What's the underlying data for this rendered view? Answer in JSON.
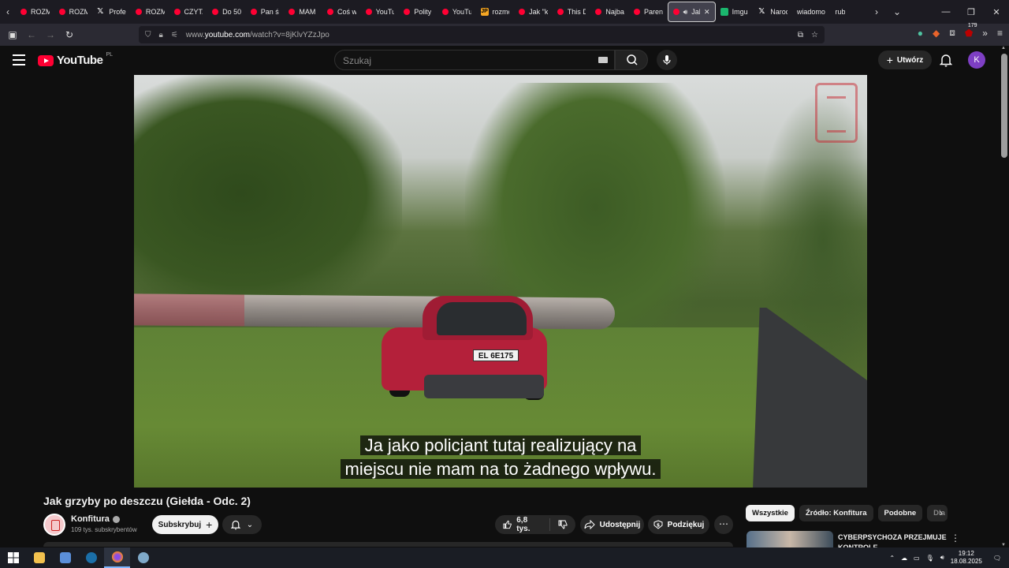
{
  "browser": {
    "tabs": [
      {
        "icon": "youtube-icon",
        "label": "ROZM"
      },
      {
        "icon": "youtube-icon",
        "label": "ROZM"
      },
      {
        "icon": "x-icon",
        "label": "Profes"
      },
      {
        "icon": "youtube-icon",
        "label": "ROZM"
      },
      {
        "icon": "youtube-icon",
        "label": "CZYTA"
      },
      {
        "icon": "youtube-icon",
        "label": "Do 50"
      },
      {
        "icon": "youtube-icon",
        "label": "Pan ś"
      },
      {
        "icon": "youtube-icon",
        "label": "MAM"
      },
      {
        "icon": "youtube-icon",
        "label": "Coś w"
      },
      {
        "icon": "youtube-icon",
        "label": "YouTu"
      },
      {
        "icon": "youtube-icon",
        "label": "Polity"
      },
      {
        "icon": "youtube-icon",
        "label": "YouTu"
      },
      {
        "icon": "jp-icon",
        "label": "rozmo"
      },
      {
        "icon": "youtube-icon",
        "label": "Jak \"k"
      },
      {
        "icon": "youtube-icon",
        "label": "This D"
      },
      {
        "icon": "youtube-icon",
        "label": "Najba"
      },
      {
        "icon": "youtube-icon",
        "label": "Paren"
      },
      {
        "icon": "youtube-icon",
        "label": "Jak",
        "active": true
      },
      {
        "icon": "imgur-icon",
        "label": "Imgu"
      },
      {
        "icon": "x-icon",
        "label": "Narod"
      },
      {
        "icon": "none",
        "label": "wiadomoś"
      },
      {
        "icon": "none",
        "label": "rub"
      }
    ],
    "url_prefix": "www.",
    "url_domain": "youtube.com",
    "url_path": "/watch?v=8jKlvYZzJpo",
    "extension_badge": "179"
  },
  "youtube": {
    "logo_text": "YouTube",
    "logo_region": "PL",
    "search_placeholder": "Szukaj",
    "create_label": "Utwórz",
    "avatar_letter": "K"
  },
  "video": {
    "plate": "EL 6E175",
    "subtitle_line1": "Ja jako policjant tutaj realizujący na",
    "subtitle_line2": "miejscu nie mam na to żadnego wpływu.",
    "title": "Jak grzyby po deszczu (Giełda - Odc. 2)"
  },
  "channel": {
    "name": "Konfitura",
    "subscribers": "109 tys. subskrybentów",
    "subscribe_label": "Subskrybuj"
  },
  "actions": {
    "likes": "6,8 tys.",
    "share_label": "Udostępnij",
    "thanks_label": "Podziękuj"
  },
  "sidebar": {
    "chips": [
      {
        "label": "Wszystkie",
        "active": true
      },
      {
        "label": "Źródło: Konfitura"
      },
      {
        "label": "Podobne"
      },
      {
        "label": "Dla"
      }
    ],
    "rec_title": "CYBERPSYCHOZA PRZEJMUJE KONTROLE"
  },
  "taskbar": {
    "time": "19:12",
    "date": "18.08.2025"
  },
  "colors": {
    "youtube_red": "#ff0033",
    "background": "#0f0f0f",
    "avatar": "#7e3fc4"
  }
}
